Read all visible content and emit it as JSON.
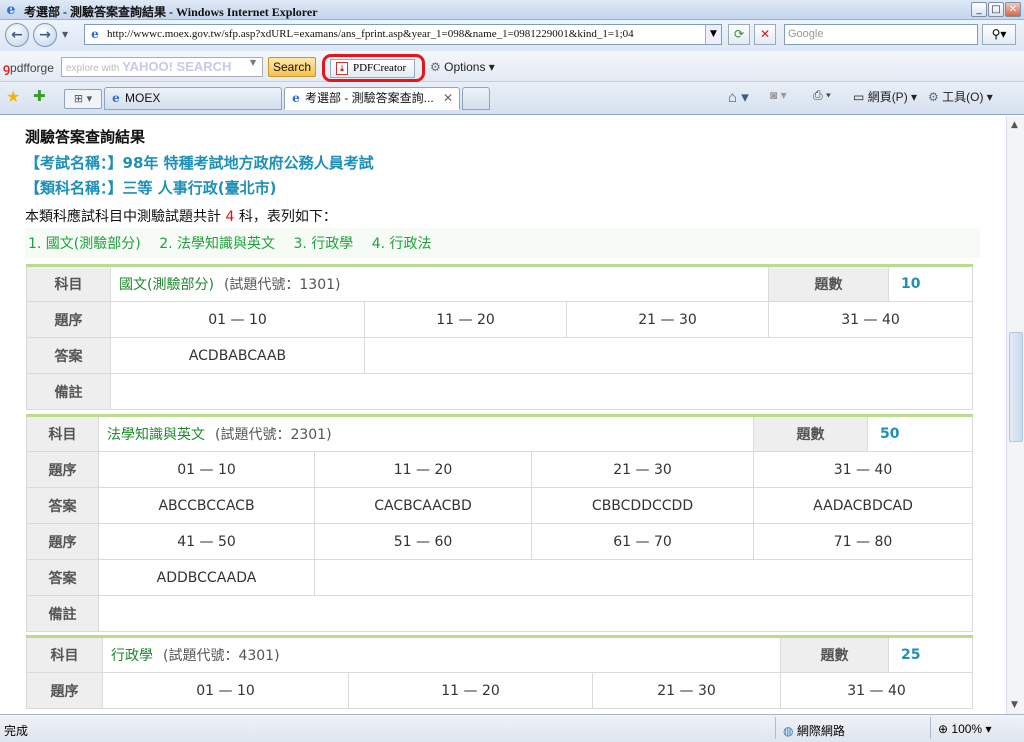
{
  "window": {
    "title": "考選部 - 測驗答案查詢結果 - Windows Internet Explorer"
  },
  "address_bar": {
    "url": "http://wwwc.moex.gov.tw/sfp.asp?xdURL=examans/ans_fprint.asp&year_1=098&name_1=0981229001&kind_1=1;04",
    "search_placeholder": "Google"
  },
  "toolbar": {
    "pdfforge_label": "pdfforge",
    "yahoo_search_text": "explore with",
    "yahoo_brand": "YAHOO! SEARCH",
    "search_button": "Search",
    "pdfcreator_button": "PDFCreator",
    "options_label": "Options"
  },
  "tabs": [
    {
      "label": "MOEX",
      "active": false
    },
    {
      "label": "考選部 - 測驗答案查詢...",
      "active": true
    }
  ],
  "command_bar": {
    "page_label": "網頁(P)",
    "tools_label": "工具(O)"
  },
  "page": {
    "title": "測驗答案查詢結果",
    "exam_name_label": "【考試名稱：】",
    "exam_name": "98年 特種考試地方政府公務人員考試",
    "category_label": "【類科名稱：】",
    "category": "三等 人事行政(臺北市)",
    "count_prefix": "本類科應試科目中測驗試題共計",
    "count_value": "4",
    "count_suffix": "科，表列如下：",
    "subject_links": [
      "1. 國文(測驗部分)",
      "2. 法學知識與英文",
      "3. 行政學",
      "4. 行政法"
    ]
  },
  "labels": {
    "subject": "科目",
    "question_count": "題數",
    "sequence": "題序",
    "answer": "答案",
    "remark": "備註"
  },
  "subjects": [
    {
      "name": "國文(測驗部分)",
      "code": "(試題代號：1301)",
      "count": "10",
      "ranges": [
        "01 — 10",
        "11 — 20",
        "21 — 30",
        "31 — 40"
      ],
      "answers": [
        "ACDBABCAAB"
      ]
    },
    {
      "name": "法學知識與英文",
      "code": "(試題代號：2301)",
      "count": "50",
      "ranges": [
        "01 — 10",
        "11 — 20",
        "21 — 30",
        "31 — 40"
      ],
      "answers": [
        "ABCCBCCACB",
        "CACBCAACBD",
        "CBBCDDCCDD",
        "AADACBDCAD"
      ],
      "ranges2": [
        "41 — 50",
        "51 — 60",
        "61 — 70",
        "71 — 80"
      ],
      "answers2": [
        "ADDBCCAADA"
      ]
    },
    {
      "name": "行政學",
      "code": "(試題代號：4301)",
      "count": "25",
      "ranges": [
        "01 — 10",
        "11 — 20",
        "21 — 30",
        "31 — 40"
      ]
    }
  ],
  "status_bar": {
    "status": "完成",
    "zone": "網際網路",
    "zoom": "100%"
  }
}
